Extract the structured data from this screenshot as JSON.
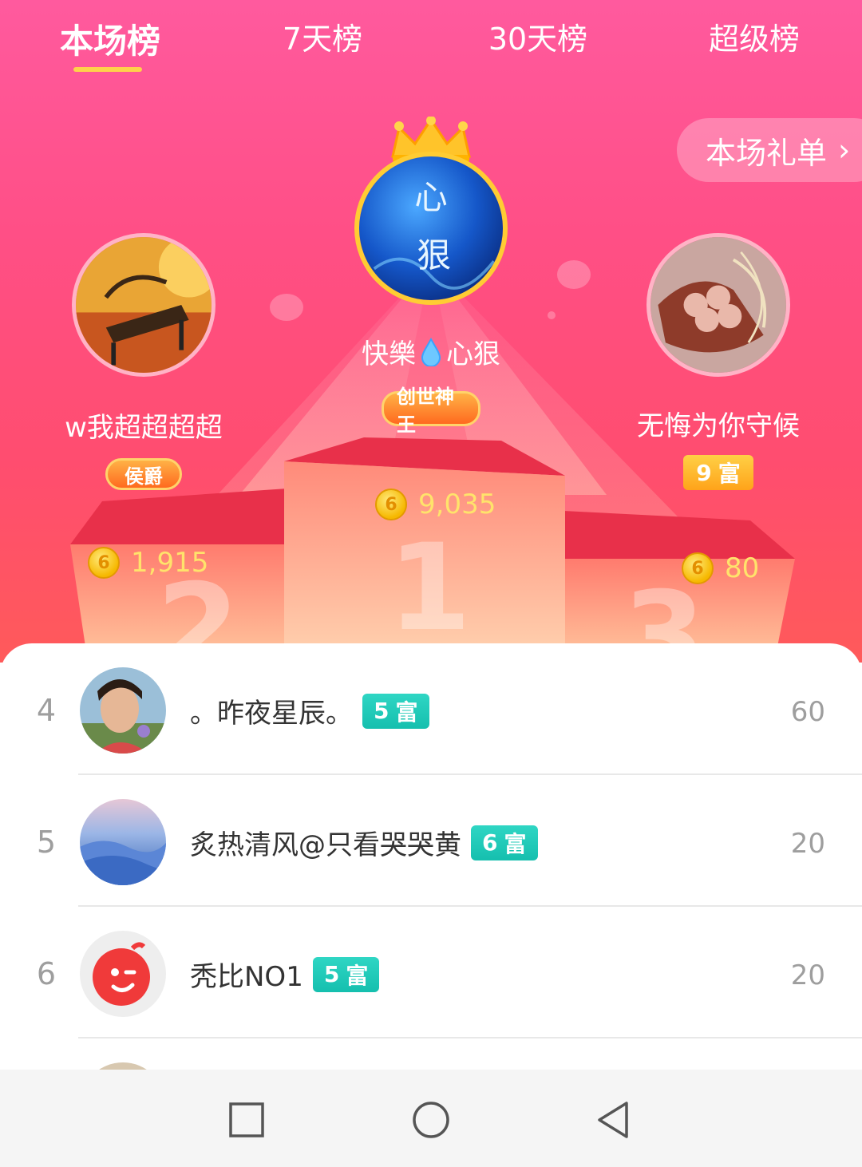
{
  "tabs": [
    {
      "label": "本场榜",
      "active": true
    },
    {
      "label": "7天榜",
      "active": false
    },
    {
      "label": "30天榜",
      "active": false
    },
    {
      "label": "超级榜",
      "active": false
    }
  ],
  "gift_list_button": {
    "label": "本场礼单",
    "chevron": "›"
  },
  "podium": {
    "first": {
      "avatar_text": [
        "心",
        "狠"
      ],
      "name_left": "快樂",
      "name_right": "心狠",
      "name_icon": "water-drop-icon",
      "badge": "创世神王",
      "coins": "9,035",
      "crown_icon": "crown-icon",
      "rank_numeral": "1"
    },
    "second": {
      "name": "w我超超超超",
      "badge": "侯爵",
      "coins": "1,915",
      "rank_numeral": "2"
    },
    "third": {
      "name": "无悔为你守候",
      "badge_level": "9",
      "badge_label": "富",
      "coins": "80",
      "rank_numeral": "3"
    },
    "coin_symbol": "6"
  },
  "ranking_list": [
    {
      "rank": "4",
      "name": "。昨夜星辰。",
      "wealth_level": "5",
      "wealth_label": "富",
      "score": "60"
    },
    {
      "rank": "5",
      "name": "炙热清风@只看哭哭黄",
      "wealth_level": "6",
      "wealth_label": "富",
      "score": "20"
    },
    {
      "rank": "6",
      "name": "秃比NO1",
      "wealth_level": "5",
      "wealth_label": "富",
      "score": "20"
    }
  ],
  "colors": {
    "accent_pink": "#ff5a9e",
    "tab_underline": "#ffd24a",
    "coin_text": "#ffe36b",
    "wealth_teal": "#15bfae",
    "wealth_gold": "#ffa31a"
  },
  "nav": {
    "recent_icon": "square-icon",
    "home_icon": "circle-icon",
    "back_icon": "triangle-back-icon"
  }
}
